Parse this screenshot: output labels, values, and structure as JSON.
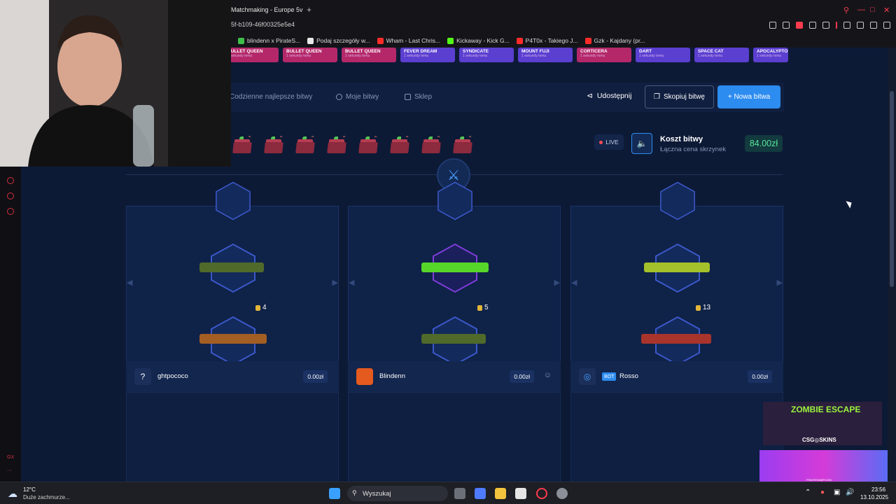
{
  "browser": {
    "tab_title": "Matchmaking - Europe 5v",
    "new_tab": "+",
    "url": "5f-b109-46f00325e5e4",
    "bookmarks": [
      {
        "label": "blindenn x PirateS...",
        "color": "#3fbf4a"
      },
      {
        "label": "Podaj szczegóły w...",
        "color": "#e8e8e8"
      },
      {
        "label": "Wham - Last Chris...",
        "color": "#ff2b2b"
      },
      {
        "label": "Kickaway - Kick G...",
        "color": "#53fc18"
      },
      {
        "label": "P4T0x - Takiego J...",
        "color": "#ff2b2b"
      },
      {
        "label": "Gzk - Kajdany (pr...",
        "color": "#ff2b2b"
      }
    ]
  },
  "case_strip": [
    {
      "name": "BULLET QUEEN",
      "sub": "1 sekundy temu",
      "color": "#b4286a"
    },
    {
      "name": "BULLET QUEEN",
      "sub": "1 sekundy temu",
      "color": "#b4286a"
    },
    {
      "name": "BULLET QUEEN",
      "sub": "1 sekundy temu",
      "color": "#b4286a"
    },
    {
      "name": "FEVER DREAM",
      "sub": "1 sekundy temu",
      "color": "#5a3fd0"
    },
    {
      "name": "SYNDICATE",
      "sub": "1 sekundy temu",
      "color": "#5a3fd0"
    },
    {
      "name": "MOUNT FUJI",
      "sub": "1 sekundy temu",
      "color": "#5a3fd0"
    },
    {
      "name": "CORTICERA",
      "sub": "1 sekundy temu",
      "color": "#b4286a"
    },
    {
      "name": "DART",
      "sub": "1 sekundy temu",
      "color": "#5a3fd0"
    },
    {
      "name": "SPACE CAT",
      "sub": "1 sekundy temu",
      "color": "#5a3fd0"
    },
    {
      "name": "APOCALYPTO",
      "sub": "1 sekundy temu",
      "color": "#5a3fd0"
    }
  ],
  "nav": {
    "daily": "Codzienne najlepsze bitwy",
    "my_battles": "Moje bitwy",
    "shop": "Sklep",
    "share": "Udostępnij",
    "copy": "Skopiuj bitwę",
    "new_battle": "+ Nowa bitwa"
  },
  "battle": {
    "live": "LIVE",
    "cost_title": "Koszt bitwy",
    "cost_sub": "Łączna cena skrzynek",
    "cost_value": "84.00zł",
    "case_count": 8
  },
  "players": [
    {
      "name": "ghtpococo",
      "value": "0.00zł",
      "count": "4",
      "avatar": "?",
      "bot": false,
      "hex_color": "#3b58c9"
    },
    {
      "name": "Blindenn",
      "value": "0.00zł",
      "count": "5",
      "avatar": "",
      "bot": false,
      "hex_color": "#7d3cd6"
    },
    {
      "name": "Rosso",
      "value": "0.00zł",
      "count": "13",
      "avatar": "",
      "bot": true,
      "bot_label": "BOT",
      "hex_color": "#3b58c9"
    }
  ],
  "ads": {
    "ad1_title": "ZOMBIE ESCAPE",
    "ad1_brand": "CSG◎SKINS",
    "ad2_brand": "PIRATESWAP.COM"
  },
  "taskbar": {
    "temp": "12°C",
    "weather": "Duże zachmurze...",
    "search": "Wyszukaj",
    "time": "23:56",
    "date": "13.10.2025"
  },
  "sidebar_text": "GX",
  "colors": {
    "accent": "#2d8cf0",
    "green_value": "#56e39a",
    "opera_red": "#ff3b4e"
  }
}
